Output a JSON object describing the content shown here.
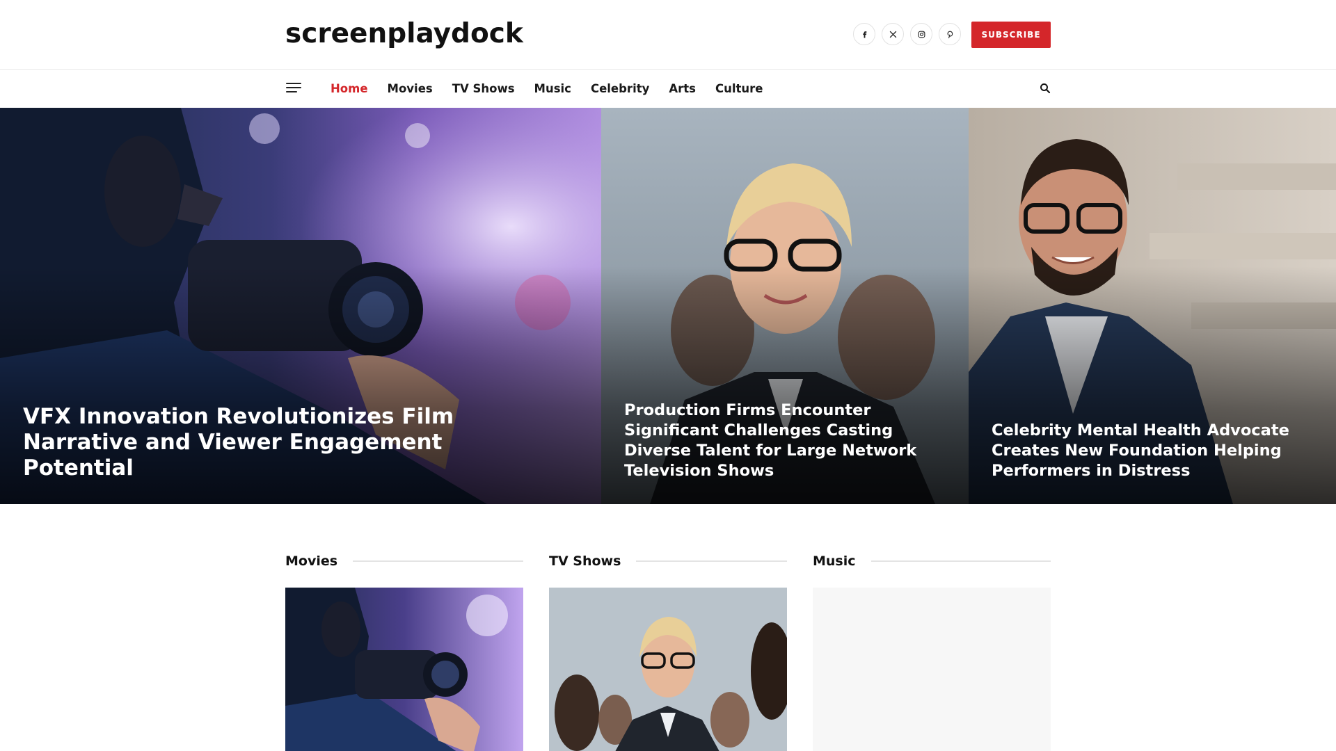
{
  "site": {
    "logo": "screenplaydock",
    "subscribe_label": "SUBSCRIBE",
    "accent_color": "#d4262a"
  },
  "socials": [
    {
      "icon": "facebook-icon"
    },
    {
      "icon": "x-icon"
    },
    {
      "icon": "instagram-icon"
    },
    {
      "icon": "pinterest-icon"
    }
  ],
  "nav": {
    "items": [
      {
        "label": "Home",
        "active": true
      },
      {
        "label": "Movies"
      },
      {
        "label": "TV Shows"
      },
      {
        "label": "Music"
      },
      {
        "label": "Celebrity"
      },
      {
        "label": "Arts"
      },
      {
        "label": "Culture"
      }
    ],
    "menu_icon": "hamburger-menu-icon",
    "search_icon": "search-icon"
  },
  "hero": [
    {
      "title": "VFX Innovation Revolutionizes Film Narrative and Viewer Engagement Potential",
      "image": "cameraman-with-headphones"
    },
    {
      "title": "Production Firms Encounter Significant Challenges Casting Diverse Talent for Large Network Television Shows",
      "image": "woman-with-glasses"
    },
    {
      "title": "Celebrity Mental Health Advocate Creates New Foundation Helping Performers in Distress",
      "image": "man-with-glasses"
    }
  ],
  "sections": [
    {
      "title": "Movies",
      "image": "cameraman-with-headphones"
    },
    {
      "title": "TV Shows",
      "image": "woman-with-glasses-group"
    },
    {
      "title": "Music",
      "image": ""
    }
  ]
}
